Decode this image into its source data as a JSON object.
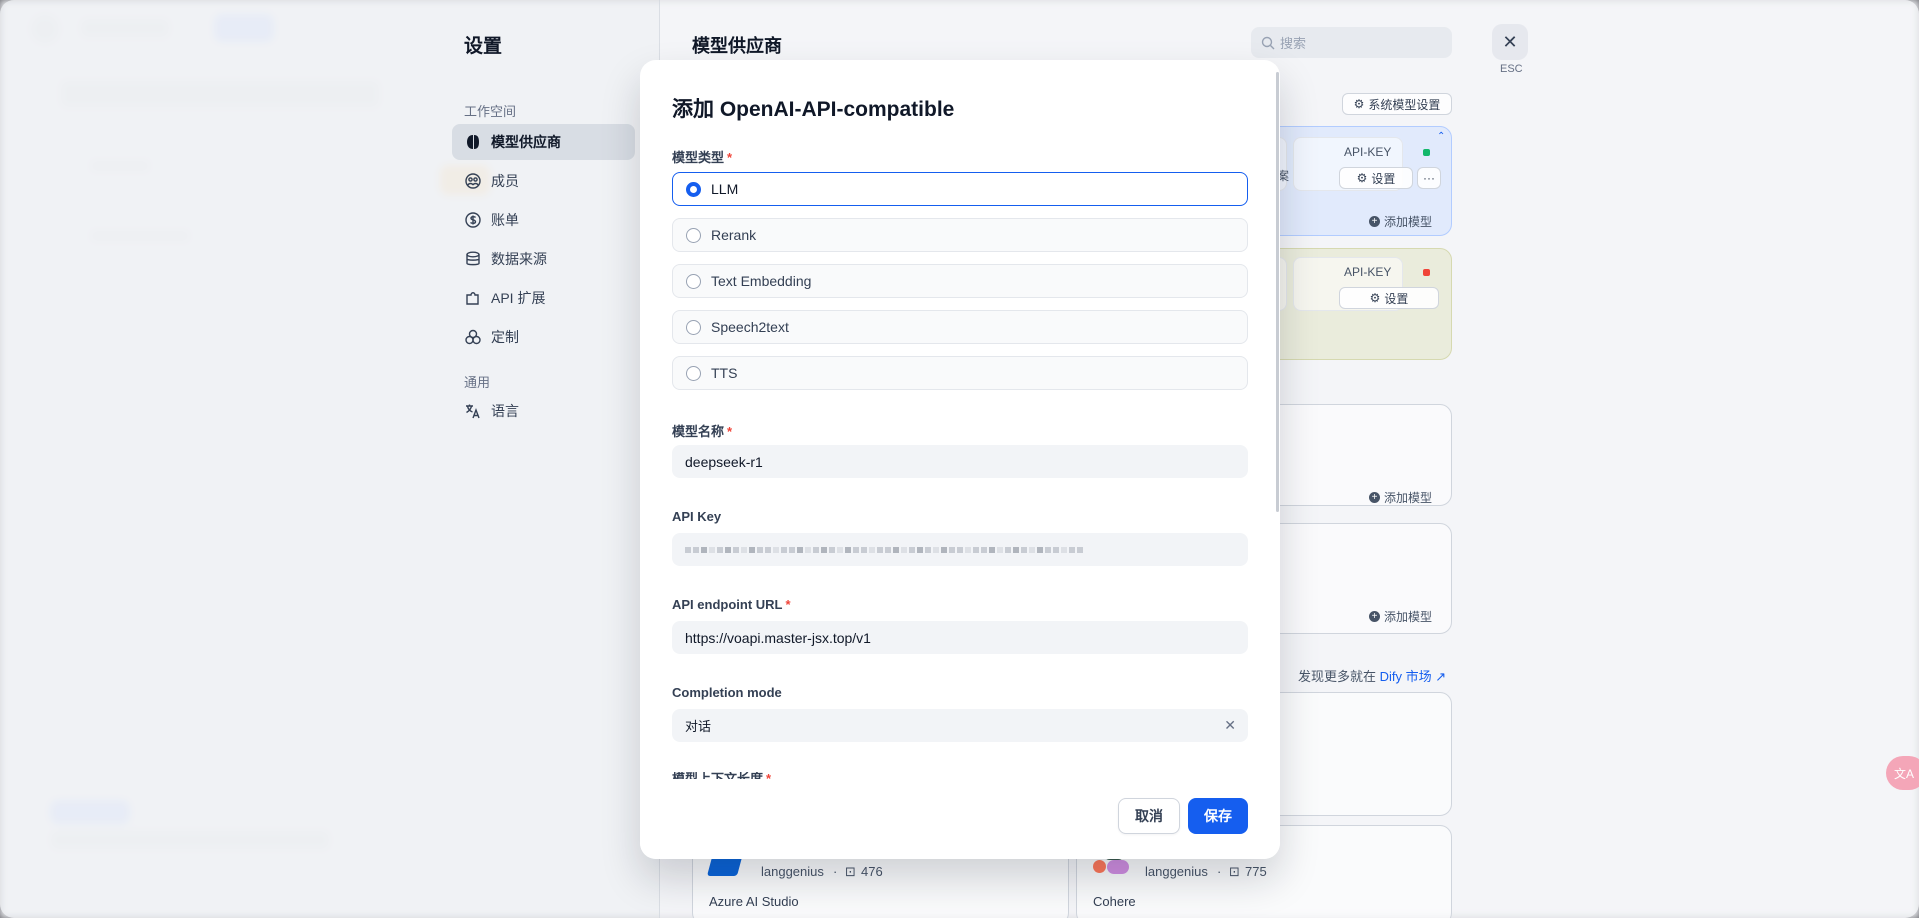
{
  "settings": {
    "title": "设置",
    "groups": {
      "workspace": "工作空间",
      "general": "通用"
    },
    "nav": [
      {
        "label": "模型供应商",
        "icon": "brain-icon",
        "active": true
      },
      {
        "label": "成员",
        "icon": "members-icon",
        "active": false
      },
      {
        "label": "账单",
        "icon": "billing-icon",
        "active": false
      },
      {
        "label": "数据来源",
        "icon": "database-icon",
        "active": false
      },
      {
        "label": "API 扩展",
        "icon": "puzzle-icon",
        "active": false
      },
      {
        "label": "定制",
        "icon": "customize-icon",
        "active": false
      }
    ],
    "general_nav": [
      {
        "label": "语言",
        "icon": "translate-icon"
      }
    ]
  },
  "providers": {
    "title": "模型供应商",
    "search_placeholder": "搜索",
    "close_label": "ESC",
    "system_model_settings": "系统模型设置",
    "cards": [
      {
        "apikey_label": "API-KEY",
        "status_color": "#12b76a",
        "set_label": "设置",
        "more_label": "···",
        "add_model": "添加模型",
        "side_text": "案"
      },
      {
        "apikey_label": "API-KEY",
        "status_color": "#f04438",
        "set_label": "设置"
      }
    ],
    "add_model_labels": [
      "添加模型",
      "添加模型"
    ],
    "marketplace_prefix": "发现更多就在",
    "marketplace_link": "Dify 市场 ↗",
    "bottom_cards": [
      {
        "author": "langgenius",
        "installs": "476",
        "name": "Azure AI Studio"
      },
      {
        "author": "langgenius",
        "installs": "775",
        "name": "Cohere"
      }
    ]
  },
  "modal": {
    "title": "添加 OpenAI-API-compatible",
    "model_type_label": "模型类型",
    "model_types": [
      {
        "label": "LLM",
        "selected": true
      },
      {
        "label": "Rerank",
        "selected": false
      },
      {
        "label": "Text Embedding",
        "selected": false
      },
      {
        "label": "Speech2text",
        "selected": false
      },
      {
        "label": "TTS",
        "selected": false
      }
    ],
    "model_name_label": "模型名称",
    "model_name_value": "deepseek-r1",
    "api_key_label": "API Key",
    "endpoint_label": "API endpoint URL",
    "endpoint_value": "https://voapi.master-jsx.top/v1",
    "completion_mode_label": "Completion mode",
    "completion_mode_value": "对话",
    "context_length_label": "模型上下文长度",
    "cancel_label": "取消",
    "save_label": "保存"
  },
  "colors": {
    "primary": "#155eef",
    "required": "#f04438"
  }
}
